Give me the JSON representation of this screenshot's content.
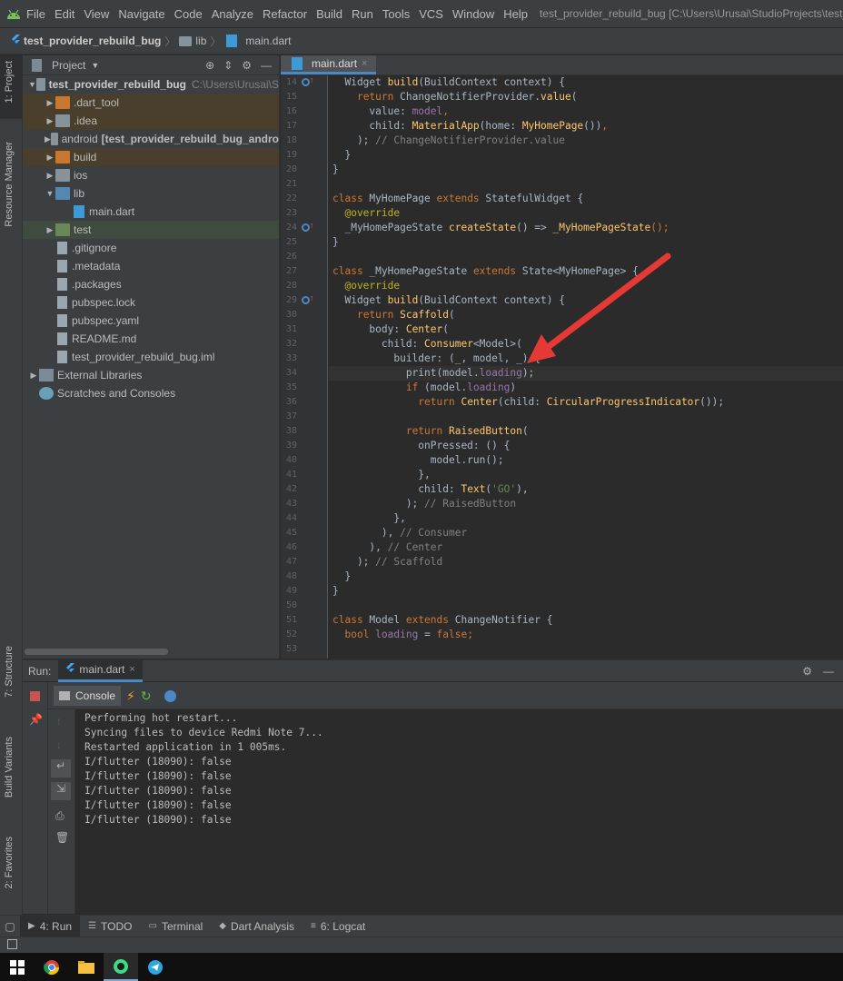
{
  "menubar": {
    "items": [
      "File",
      "Edit",
      "View",
      "Navigate",
      "Code",
      "Analyze",
      "Refactor",
      "Build",
      "Run",
      "Tools",
      "VCS",
      "Window",
      "Help"
    ],
    "window_title": "test_provider_rebuild_bug [C:\\Users\\Urusai\\StudioProjects\\test_p"
  },
  "breadcrumb": [
    "test_provider_rebuild_bug",
    "lib",
    "main.dart"
  ],
  "left_stripe": {
    "project": "1: Project",
    "resource": "Resource Manager",
    "structure": "7: Structure",
    "variants": "Build Variants",
    "favorites": "2: Favorites"
  },
  "project_panel": {
    "title": "Project",
    "tree": [
      {
        "label": "test_provider_rebuild_bug",
        "hint": "C:\\Users\\Urusai\\S",
        "bold": true
      },
      {
        "label": ".dart_tool"
      },
      {
        "label": ".idea"
      },
      {
        "label": "android",
        "extra": "[test_provider_rebuild_bug_andro"
      },
      {
        "label": "build"
      },
      {
        "label": "ios"
      },
      {
        "label": "lib"
      },
      {
        "label": "main.dart"
      },
      {
        "label": "test"
      },
      {
        "label": ".gitignore"
      },
      {
        "label": ".metadata"
      },
      {
        "label": ".packages"
      },
      {
        "label": "pubspec.lock"
      },
      {
        "label": "pubspec.yaml"
      },
      {
        "label": "README.md"
      },
      {
        "label": "test_provider_rebuild_bug.iml"
      },
      {
        "label": "External Libraries"
      },
      {
        "label": "Scratches and Consoles"
      }
    ]
  },
  "editor": {
    "tab": "main.dart",
    "first_line": 14,
    "lines": [
      [
        [
          "  Widget ",
          "ty"
        ],
        [
          "build",
          "fn"
        ],
        [
          "(BuildContext context) {",
          "ty"
        ]
      ],
      [
        [
          "    ",
          "ty"
        ],
        [
          "return ",
          "kw"
        ],
        [
          "ChangeNotifierProvider.",
          "ty"
        ],
        [
          "value",
          "fn"
        ],
        [
          "(",
          "ty"
        ]
      ],
      [
        [
          "      value: ",
          "ty"
        ],
        [
          "model",
          "fld"
        ],
        [
          ",",
          "kw"
        ]
      ],
      [
        [
          "      child: ",
          "ty"
        ],
        [
          "MaterialApp",
          "fn"
        ],
        [
          "(home: ",
          "ty"
        ],
        [
          "MyHomePage",
          "fn"
        ],
        [
          "())",
          "ty"
        ],
        [
          ",",
          "kw"
        ]
      ],
      [
        [
          "    ); ",
          "ty"
        ],
        [
          "// ChangeNotifierProvider.value",
          "cm"
        ]
      ],
      [
        [
          "  }",
          "ty"
        ]
      ],
      [
        [
          "}",
          "ty"
        ]
      ],
      [
        [
          "",
          "ty"
        ]
      ],
      [
        [
          "class ",
          "kw"
        ],
        [
          "MyHomePage ",
          "ty"
        ],
        [
          "extends ",
          "kw"
        ],
        [
          "StatefulWidget {",
          "ty"
        ]
      ],
      [
        [
          "  @override",
          "ann"
        ]
      ],
      [
        [
          "  _MyHomePageState ",
          "ty"
        ],
        [
          "createState",
          "fn"
        ],
        [
          "() => ",
          "ty"
        ],
        [
          "_MyHomePageState",
          "fn"
        ],
        [
          "();",
          "kw"
        ]
      ],
      [
        [
          "}",
          "ty"
        ]
      ],
      [
        [
          "",
          "ty"
        ]
      ],
      [
        [
          "class ",
          "kw"
        ],
        [
          "_MyHomePageState ",
          "ty"
        ],
        [
          "extends ",
          "kw"
        ],
        [
          "State<MyHomePage> {",
          "ty"
        ]
      ],
      [
        [
          "  @override",
          "ann"
        ]
      ],
      [
        [
          "  Widget ",
          "ty"
        ],
        [
          "build",
          "fn"
        ],
        [
          "(BuildContext context) {",
          "ty"
        ]
      ],
      [
        [
          "    ",
          "ty"
        ],
        [
          "return ",
          "kw"
        ],
        [
          "Scaffold",
          "fn"
        ],
        [
          "(",
          "ty"
        ]
      ],
      [
        [
          "      body: ",
          "ty"
        ],
        [
          "Center",
          "fn"
        ],
        [
          "(",
          "ty"
        ]
      ],
      [
        [
          "        child: ",
          "ty"
        ],
        [
          "Consumer",
          "fn"
        ],
        [
          "<Model>(",
          "ty"
        ]
      ],
      [
        [
          "          builder: (_, model, _) {",
          "ty"
        ]
      ],
      [
        [
          "            print(model.",
          "ty"
        ],
        [
          "loading",
          "fld"
        ],
        [
          ");",
          "ty"
        ]
      ],
      [
        [
          "            ",
          "ty"
        ],
        [
          "if ",
          "kw"
        ],
        [
          "(model.",
          "ty"
        ],
        [
          "loading",
          "fld"
        ],
        [
          ")",
          "ty"
        ]
      ],
      [
        [
          "              ",
          "ty"
        ],
        [
          "return ",
          "kw"
        ],
        [
          "Center",
          "fn"
        ],
        [
          "(child: ",
          "ty"
        ],
        [
          "CircularProgressIndicator",
          "fn"
        ],
        [
          "());",
          "ty"
        ]
      ],
      [
        [
          "",
          "ty"
        ]
      ],
      [
        [
          "            ",
          "ty"
        ],
        [
          "return ",
          "kw"
        ],
        [
          "RaisedButton",
          "fn"
        ],
        [
          "(",
          "ty"
        ]
      ],
      [
        [
          "              onPressed: () {",
          "ty"
        ]
      ],
      [
        [
          "                model.run();",
          "ty"
        ]
      ],
      [
        [
          "              },",
          "ty"
        ]
      ],
      [
        [
          "              child: ",
          "ty"
        ],
        [
          "Text",
          "fn"
        ],
        [
          "(",
          "ty"
        ],
        [
          "'GO'",
          "str"
        ],
        [
          "),",
          "ty"
        ]
      ],
      [
        [
          "            ); ",
          "ty"
        ],
        [
          "// RaisedButton",
          "cm"
        ]
      ],
      [
        [
          "          },",
          "ty"
        ]
      ],
      [
        [
          "        ), ",
          "ty"
        ],
        [
          "// Consumer",
          "cm"
        ]
      ],
      [
        [
          "      ), ",
          "ty"
        ],
        [
          "// Center",
          "cm"
        ]
      ],
      [
        [
          "    ); ",
          "ty"
        ],
        [
          "// Scaffold",
          "cm"
        ]
      ],
      [
        [
          "  }",
          "ty"
        ]
      ],
      [
        [
          "}",
          "ty"
        ]
      ],
      [
        [
          "",
          "ty"
        ]
      ],
      [
        [
          "class ",
          "kw"
        ],
        [
          "Model ",
          "ty"
        ],
        [
          "extends ",
          "kw"
        ],
        [
          "ChangeNotifier {",
          "ty"
        ]
      ],
      [
        [
          "  ",
          "ty"
        ],
        [
          "bool ",
          "kw"
        ],
        [
          "loading ",
          "fld"
        ],
        [
          "= ",
          "ty"
        ],
        [
          "false",
          "kw"
        ],
        [
          ";",
          "kw"
        ]
      ],
      [
        [
          "",
          "ty"
        ]
      ]
    ]
  },
  "run_panel": {
    "label": "Run:",
    "tab": "main.dart",
    "console_label": "Console",
    "output": [
      "Performing hot restart...",
      "Syncing files to device Redmi Note 7...",
      "Restarted application in 1 005ms.",
      "I/flutter (18090): false",
      "I/flutter (18090): false",
      "I/flutter (18090): false",
      "I/flutter (18090): false",
      "I/flutter (18090): false"
    ]
  },
  "bottom_tabs": [
    {
      "label": "4: Run",
      "icon": "play-icon"
    },
    {
      "label": "TODO",
      "icon": "list-icon"
    },
    {
      "label": "Terminal",
      "icon": "terminal-icon"
    },
    {
      "label": "Dart Analysis",
      "icon": "dart-analysis-icon"
    },
    {
      "label": "6: Logcat",
      "icon": "logcat-icon"
    }
  ],
  "colors": {
    "accent": "#4a88c7",
    "arrow": "#e53935"
  }
}
